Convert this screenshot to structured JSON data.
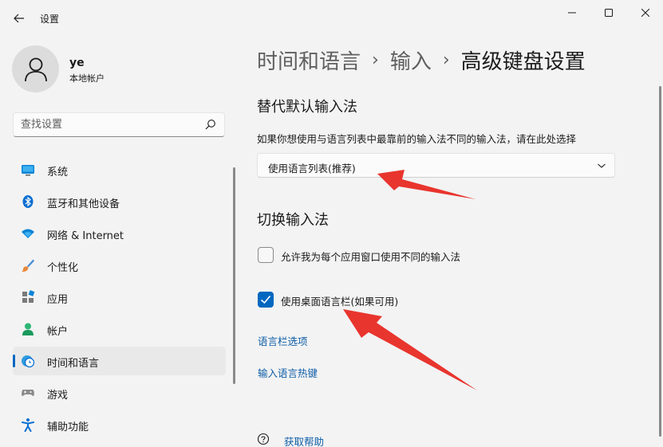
{
  "window": {
    "title": "设置",
    "controls": [
      "minimize",
      "maximize",
      "close"
    ]
  },
  "user": {
    "name": "ye",
    "account_type": "本地帐户"
  },
  "search": {
    "placeholder": "查找设置"
  },
  "sidebar": {
    "items": [
      {
        "label": "系统",
        "icon": "system-icon"
      },
      {
        "label": "蓝牙和其他设备",
        "icon": "bluetooth-icon"
      },
      {
        "label": "网络 & Internet",
        "icon": "network-icon"
      },
      {
        "label": "个性化",
        "icon": "personalization-icon"
      },
      {
        "label": "应用",
        "icon": "apps-icon"
      },
      {
        "label": "帐户",
        "icon": "accounts-icon"
      },
      {
        "label": "时间和语言",
        "icon": "time-language-icon",
        "active": true
      },
      {
        "label": "游戏",
        "icon": "gaming-icon"
      },
      {
        "label": "辅助功能",
        "icon": "accessibility-icon"
      }
    ]
  },
  "breadcrumb": {
    "items": [
      "时间和语言",
      "输入",
      "高级键盘设置"
    ],
    "separator": "›"
  },
  "main": {
    "override_title": "替代默认输入法",
    "override_desc": "如果你想使用与语言列表中最靠前的输入法不同的输入法，请在此处选择",
    "dropdown_value": "使用语言列表(推荐)",
    "switch_title": "切换输入法",
    "checkboxes": [
      {
        "label": "允许我为每个应用窗口使用不同的输入法",
        "checked": false
      },
      {
        "label": "使用桌面语言栏(如果可用)",
        "checked": true
      }
    ],
    "links": [
      "语言栏选项",
      "输入语言热键"
    ],
    "help_link": "获取帮助"
  },
  "colors": {
    "accent": "#0067c0",
    "link": "#0f5ea8",
    "annotation_arrow": "#e8352e",
    "background": "#f3f3f3"
  }
}
